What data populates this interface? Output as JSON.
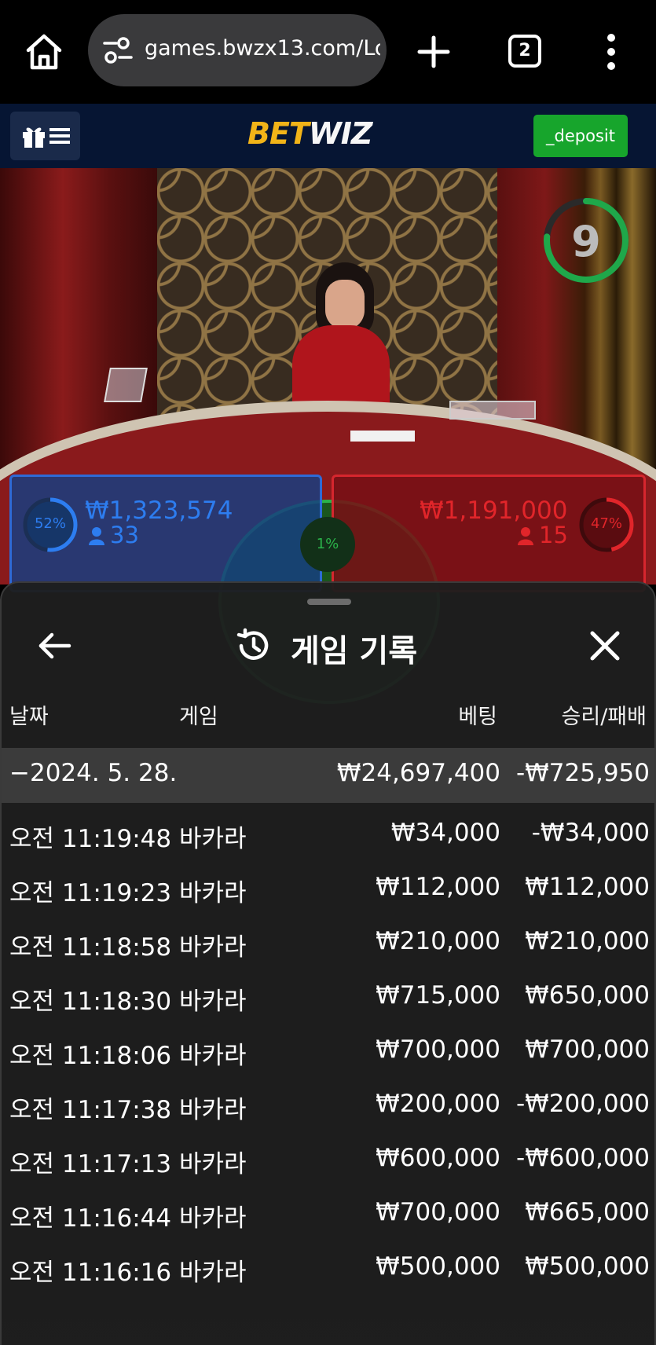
{
  "browser": {
    "url": "games.bwzx13.com/Lo",
    "tab_count": "2"
  },
  "header": {
    "brand_part1": "BET",
    "brand_part2": "WIZ",
    "deposit_label": "_deposit"
  },
  "game": {
    "timer": "9",
    "player": {
      "percent": "52%",
      "amount": "₩1,323,574",
      "count": "33"
    },
    "banker": {
      "percent": "47%",
      "amount": "₩1,191,000",
      "count": "15"
    },
    "tie": {
      "percent": "1%"
    },
    "colors": {
      "player": "#2d7df0",
      "banker": "#e1252a",
      "tie": "#2bb34a",
      "timer": "#1fa84a"
    }
  },
  "history": {
    "title": "게임 기록",
    "columns": {
      "date": "날짜",
      "game": "게임",
      "bet": "베팅",
      "result": "승리/패배"
    },
    "summary": {
      "date": "−2024. 5. 28.",
      "bet": "₩24,697,400",
      "result": "-₩725,950"
    },
    "rows": [
      {
        "time": "오전 11:19:48",
        "game": "바카라",
        "bet": "₩34,000",
        "result": "-₩34,000"
      },
      {
        "time": "오전 11:19:23",
        "game": "바카라",
        "bet": "₩112,000",
        "result": "₩112,000"
      },
      {
        "time": "오전 11:18:58",
        "game": "바카라",
        "bet": "₩210,000",
        "result": "₩210,000"
      },
      {
        "time": "오전 11:18:30",
        "game": "바카라",
        "bet": "₩715,000",
        "result": "₩650,000"
      },
      {
        "time": "오전 11:18:06",
        "game": "바카라",
        "bet": "₩700,000",
        "result": "₩700,000"
      },
      {
        "time": "오전 11:17:38",
        "game": "바카라",
        "bet": "₩200,000",
        "result": "-₩200,000"
      },
      {
        "time": "오전 11:17:13",
        "game": "바카라",
        "bet": "₩600,000",
        "result": "-₩600,000"
      },
      {
        "time": "오전 11:16:44",
        "game": "바카라",
        "bet": "₩700,000",
        "result": "₩665,000"
      },
      {
        "time": "오전 11:16:16",
        "game": "바카라",
        "bet": "₩500,000",
        "result": "₩500,000"
      }
    ]
  }
}
